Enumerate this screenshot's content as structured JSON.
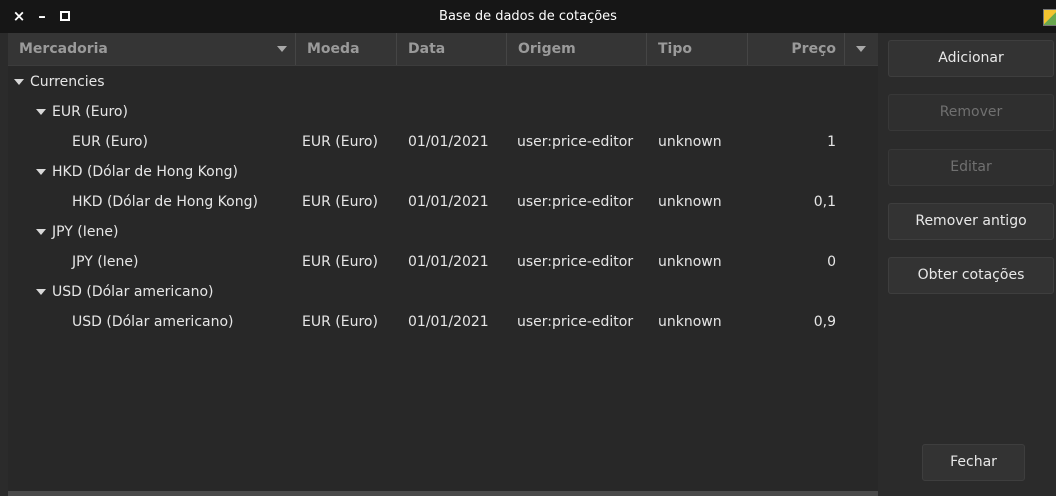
{
  "window": {
    "title": "Base de dados de cotações",
    "close_glyph": "×",
    "min_glyph": "–"
  },
  "table": {
    "columns": {
      "mercadoria": "Mercadoria",
      "moeda": "Moeda",
      "data": "Data",
      "origem": "Origem",
      "tipo": "Tipo",
      "preco": "Preço"
    },
    "root": "Currencies",
    "groups": [
      {
        "name": "EUR (Euro)",
        "row": {
          "mercadoria": "EUR (Euro)",
          "moeda": "EUR (Euro)",
          "data": "01/01/2021",
          "origem": "user:price-editor",
          "tipo": "unknown",
          "preco": "1"
        }
      },
      {
        "name": "HKD (Dólar de Hong Kong)",
        "row": {
          "mercadoria": "HKD (Dólar de Hong Kong)",
          "moeda": "EUR (Euro)",
          "data": "01/01/2021",
          "origem": "user:price-editor",
          "tipo": "unknown",
          "preco": "0,1"
        }
      },
      {
        "name": "JPY (Iene)",
        "row": {
          "mercadoria": "JPY (Iene)",
          "moeda": "EUR (Euro)",
          "data": "01/01/2021",
          "origem": "user:price-editor",
          "tipo": "unknown",
          "preco": "0"
        }
      },
      {
        "name": "USD (Dólar americano)",
        "row": {
          "mercadoria": "USD (Dólar americano)",
          "moeda": "EUR (Euro)",
          "data": "01/01/2021",
          "origem": "user:price-editor",
          "tipo": "unknown",
          "preco": "0,9"
        }
      }
    ]
  },
  "buttons": {
    "adicionar": "Adicionar",
    "remover": "Remover",
    "editar": "Editar",
    "remover_antigo": "Remover antigo",
    "obter_cotacoes": "Obter cotações",
    "fechar": "Fechar"
  },
  "states": {
    "remover_enabled": false,
    "editar_enabled": false
  }
}
